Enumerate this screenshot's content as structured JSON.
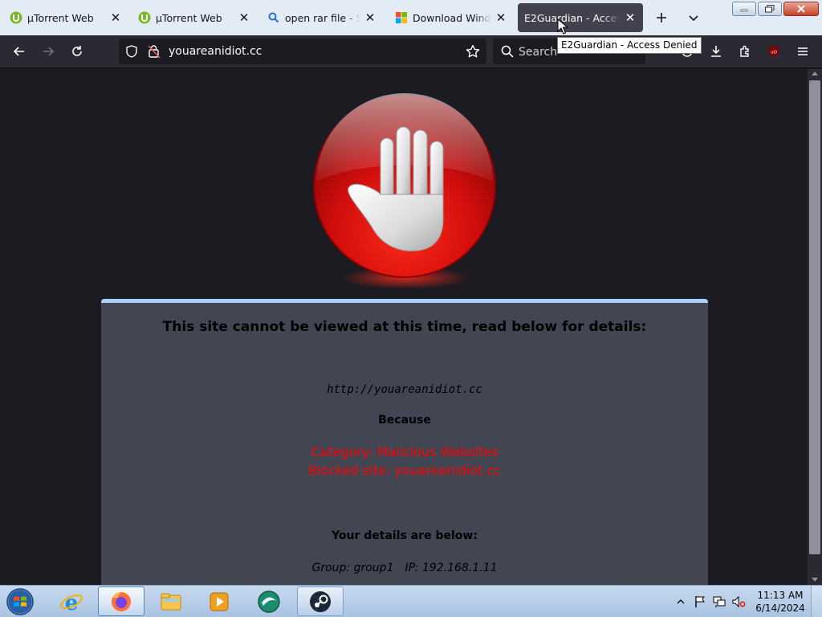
{
  "browser": {
    "tabs": [
      {
        "title": "µTorrent Web",
        "icon": "utorrent-icon",
        "active": false
      },
      {
        "title": "µTorrent Web",
        "icon": "utorrent-icon",
        "active": false
      },
      {
        "title": "open rar file - Search",
        "icon": "search-icon",
        "active": false
      },
      {
        "title": "Download Windows",
        "icon": "microsoft-icon",
        "active": false
      },
      {
        "title": "E2Guardian - Access Denied",
        "icon": "",
        "active": true
      }
    ],
    "url": "youareanidiot.cc",
    "search_placeholder": "Search",
    "tooltip": "E2Guardian - Access Denied"
  },
  "page": {
    "heading": "This site cannot be viewed at this time, read below for details:",
    "blocked_url": "http://youareanidiot.cc",
    "because_label": "Because",
    "reason_category": "Category: Malicious Websites",
    "reason_blocked": "Blocked site: youareanidiot.cc",
    "details_heading": "Your details are below:",
    "group": "Group: group1",
    "ip": "IP: 192.168.1.11"
  },
  "taskbar": {
    "apps": [
      "internet-explorer-icon",
      "firefox-icon",
      "file-explorer-icon",
      "media-player-icon",
      "browser-globe-icon",
      "steam-icon"
    ],
    "time": "11:13 AM",
    "date": "6/14/2024"
  },
  "colors": {
    "accent_blue": "#a9d1ff",
    "blocked_red": "#ff0000",
    "panel": "#424552",
    "page_bg": "#1c1b22"
  }
}
